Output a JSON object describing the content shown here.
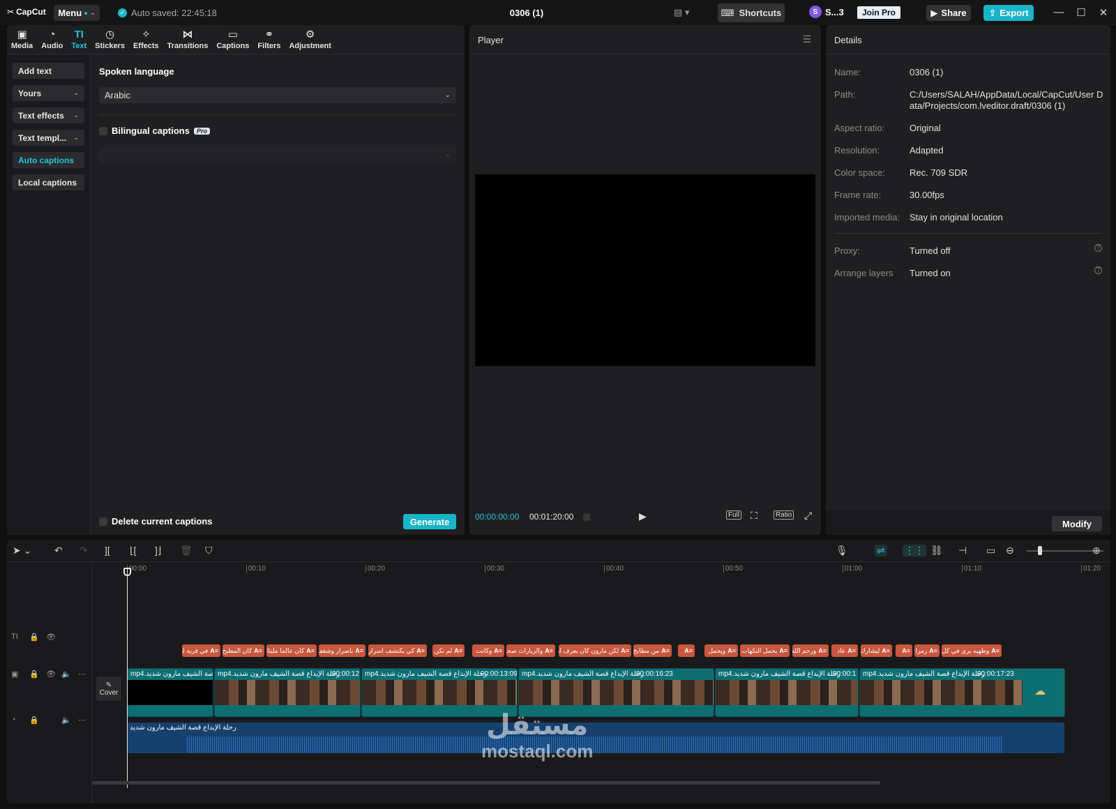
{
  "app": {
    "logo": "CapCut",
    "menu_label": "Menu",
    "auto_saved": "Auto saved: 22:45:18",
    "project_title": "0306 (1)",
    "shortcuts_label": "Shortcuts",
    "user_initial": "S",
    "user_name": "S...3",
    "join_pro": "Join Pro",
    "share_label": "Share",
    "export_label": "Export"
  },
  "tools": [
    {
      "label": "Media",
      "icon": "media-icon"
    },
    {
      "label": "Audio",
      "icon": "audio-icon"
    },
    {
      "label": "Text",
      "icon": "text-icon"
    },
    {
      "label": "Stickers",
      "icon": "stickers-icon"
    },
    {
      "label": "Effects",
      "icon": "effects-icon"
    },
    {
      "label": "Transitions",
      "icon": "transitions-icon"
    },
    {
      "label": "Captions",
      "icon": "captions-icon"
    },
    {
      "label": "Filters",
      "icon": "filters-icon"
    },
    {
      "label": "Adjustment",
      "icon": "adjustment-icon"
    }
  ],
  "sidebar": {
    "items": [
      "Add text",
      "Yours",
      "Text effects",
      "Text templ...",
      "Auto captions",
      "Local captions"
    ]
  },
  "captions_panel": {
    "spoken_language_label": "Spoken language",
    "spoken_language_value": "Arabic",
    "bilingual_label": "Bilingual captions",
    "pro_badge": "Pro",
    "delete_label": "Delete current captions",
    "generate_label": "Generate"
  },
  "player": {
    "title": "Player",
    "current_time": "00:00:00:00",
    "total_time": "00:01:20:00",
    "full_label": "Full",
    "ratio_label": "Ratio"
  },
  "details": {
    "title": "Details",
    "rows": [
      {
        "key": "Name:",
        "value": "0306 (1)"
      },
      {
        "key": "Path:",
        "value": "C:/Users/SALAH/AppData/Local/CapCut/User Data/Projects/com.lveditor.draft/0306 (1)"
      },
      {
        "key": "Aspect ratio:",
        "value": "Original"
      },
      {
        "key": "Resolution:",
        "value": "Adapted"
      },
      {
        "key": "Color space:",
        "value": "Rec. 709 SDR"
      },
      {
        "key": "Frame rate:",
        "value": "30.00fps"
      },
      {
        "key": "Imported media:",
        "value": "Stay in original location"
      },
      {
        "key": "Proxy:",
        "value": "Turned off"
      },
      {
        "key": "Arrange layers",
        "value": "Turned on"
      }
    ],
    "modify_label": "Modify"
  },
  "timeline": {
    "ruler": [
      "00:00",
      "00:10",
      "00:20",
      "00:30",
      "00:40",
      "00:50",
      "01:00",
      "01:10",
      "01:20"
    ],
    "cover_label": "Cover",
    "caption_clips": [
      "في قرية لبنانية",
      "كان المطبخ",
      "كان عالما مليئا",
      "باصرار وشغف",
      "كي يكتشف اسرار",
      "لم تكن",
      "وكانت",
      "والزيارات صحبة",
      "لكن مارون كان يعرف ان",
      "من مطابخ",
      "",
      "ويحمل",
      "يحمل النكهات",
      "ورحم الله",
      "عاد",
      "ليشارك",
      "",
      "رمزا",
      "وطهيه يرى في كل"
    ],
    "video_clips": [
      {
        "label": "mp4.رحلة الإبداع قصة الشيف مارون شديد",
        "time": ""
      },
      {
        "label": "mp4.رحلة الإبداع قصة الشيف مارون شديد",
        "time": "00:00:12"
      },
      {
        "label": "mp4.رحلة الإبداع قصة الشيف مارون شديد",
        "time": "00:00:13:09"
      },
      {
        "label": "mp4.رحلة الإبداع قصة الشيف مارون شديد",
        "time": "00:00:16:23"
      },
      {
        "label": "mp4.رحلة الإبداع قصة الشيف مارون شديد",
        "time": "00:00:1"
      },
      {
        "label": "mp4.رحلة الإبداع قصة الشيف مارون شديد",
        "time": "00:00:17:23"
      }
    ],
    "audio_label": "رحلة الإبداع قصة الشيف مارون شديد"
  },
  "watermark": {
    "arabic": "مستقل",
    "latin": "mostaql.com"
  }
}
